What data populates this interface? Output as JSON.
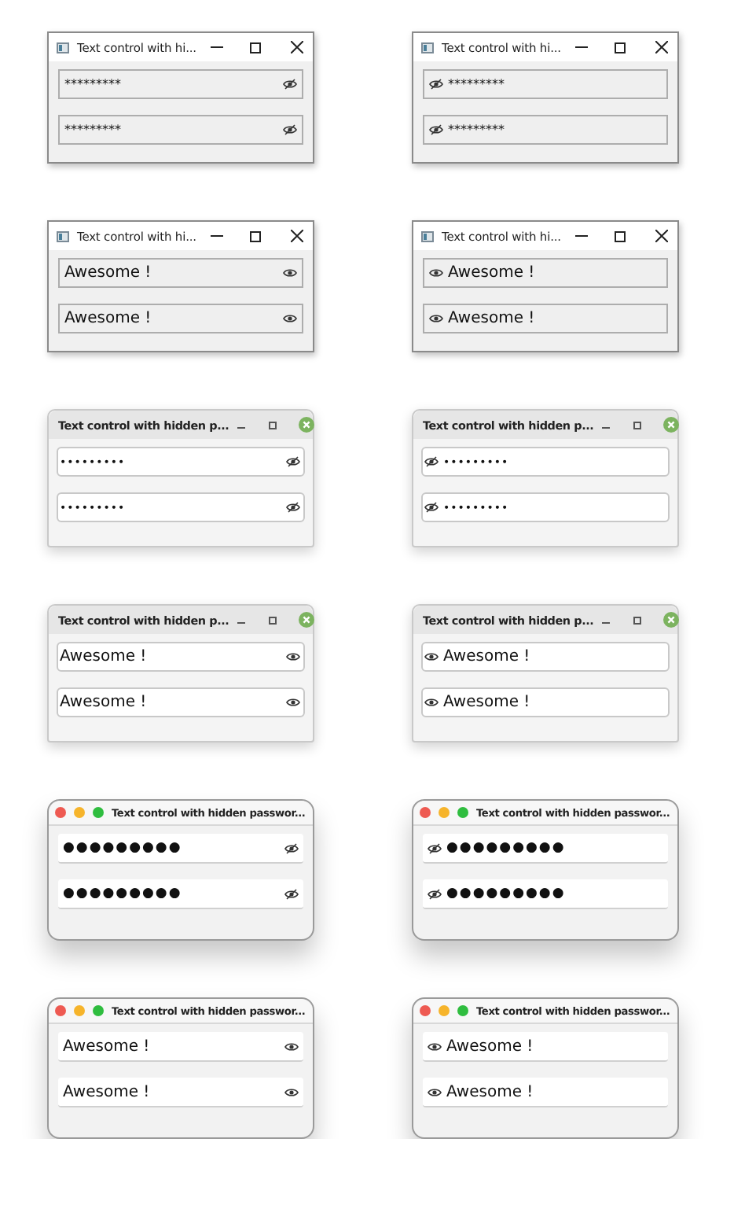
{
  "windows": [
    {
      "kind": "windows",
      "title": "Text control with hi...",
      "icon_left": false,
      "fields": [
        {
          "value": "*********",
          "revealed": false
        },
        {
          "value": "*********",
          "revealed": false
        }
      ]
    },
    {
      "kind": "windows",
      "title": "Text control with hi...",
      "icon_left": true,
      "fields": [
        {
          "value": "*********",
          "revealed": false
        },
        {
          "value": "*********",
          "revealed": false
        }
      ]
    },
    {
      "kind": "windows",
      "title": "Text control with hi...",
      "icon_left": false,
      "fields": [
        {
          "value": "Awesome !",
          "revealed": true
        },
        {
          "value": "Awesome !",
          "revealed": true
        }
      ]
    },
    {
      "kind": "windows",
      "title": "Text control with hi...",
      "icon_left": true,
      "fields": [
        {
          "value": "Awesome !",
          "revealed": true
        },
        {
          "value": "Awesome !",
          "revealed": true
        }
      ]
    },
    {
      "kind": "gtk",
      "title": "Text control with hidden p...",
      "icon_left": false,
      "fields": [
        {
          "value": "•••••••••",
          "revealed": false
        },
        {
          "value": "•••••••••",
          "revealed": false
        }
      ]
    },
    {
      "kind": "gtk",
      "title": "Text control with hidden p...",
      "icon_left": true,
      "fields": [
        {
          "value": "•••••••••",
          "revealed": false
        },
        {
          "value": "•••••••••",
          "revealed": false
        }
      ]
    },
    {
      "kind": "gtk",
      "title": "Text control with hidden p...",
      "icon_left": false,
      "fields": [
        {
          "value": "Awesome !",
          "revealed": true
        },
        {
          "value": "Awesome !",
          "revealed": true
        }
      ]
    },
    {
      "kind": "gtk",
      "title": "Text control with hidden p...",
      "icon_left": true,
      "fields": [
        {
          "value": "Awesome !",
          "revealed": true
        },
        {
          "value": "Awesome !",
          "revealed": true
        }
      ]
    },
    {
      "kind": "mac",
      "title": "Text control with hidden passwor...",
      "icon_left": false,
      "fields": [
        {
          "value": "●●●●●●●●●",
          "revealed": false
        },
        {
          "value": "●●●●●●●●●",
          "revealed": false
        }
      ]
    },
    {
      "kind": "mac",
      "title": "Text control with hidden passwor...",
      "icon_left": true,
      "fields": [
        {
          "value": "●●●●●●●●●",
          "revealed": false
        },
        {
          "value": "●●●●●●●●●",
          "revealed": false
        }
      ]
    },
    {
      "kind": "mac",
      "title": "Text control with hidden passwor...",
      "icon_left": false,
      "fields": [
        {
          "value": "Awesome !",
          "revealed": true
        },
        {
          "value": "Awesome !",
          "revealed": true
        }
      ]
    },
    {
      "kind": "mac",
      "title": "Text control with hidden passwor...",
      "icon_left": true,
      "fields": [
        {
          "value": "Awesome !",
          "revealed": true
        },
        {
          "value": "Awesome !",
          "revealed": true
        }
      ]
    }
  ]
}
